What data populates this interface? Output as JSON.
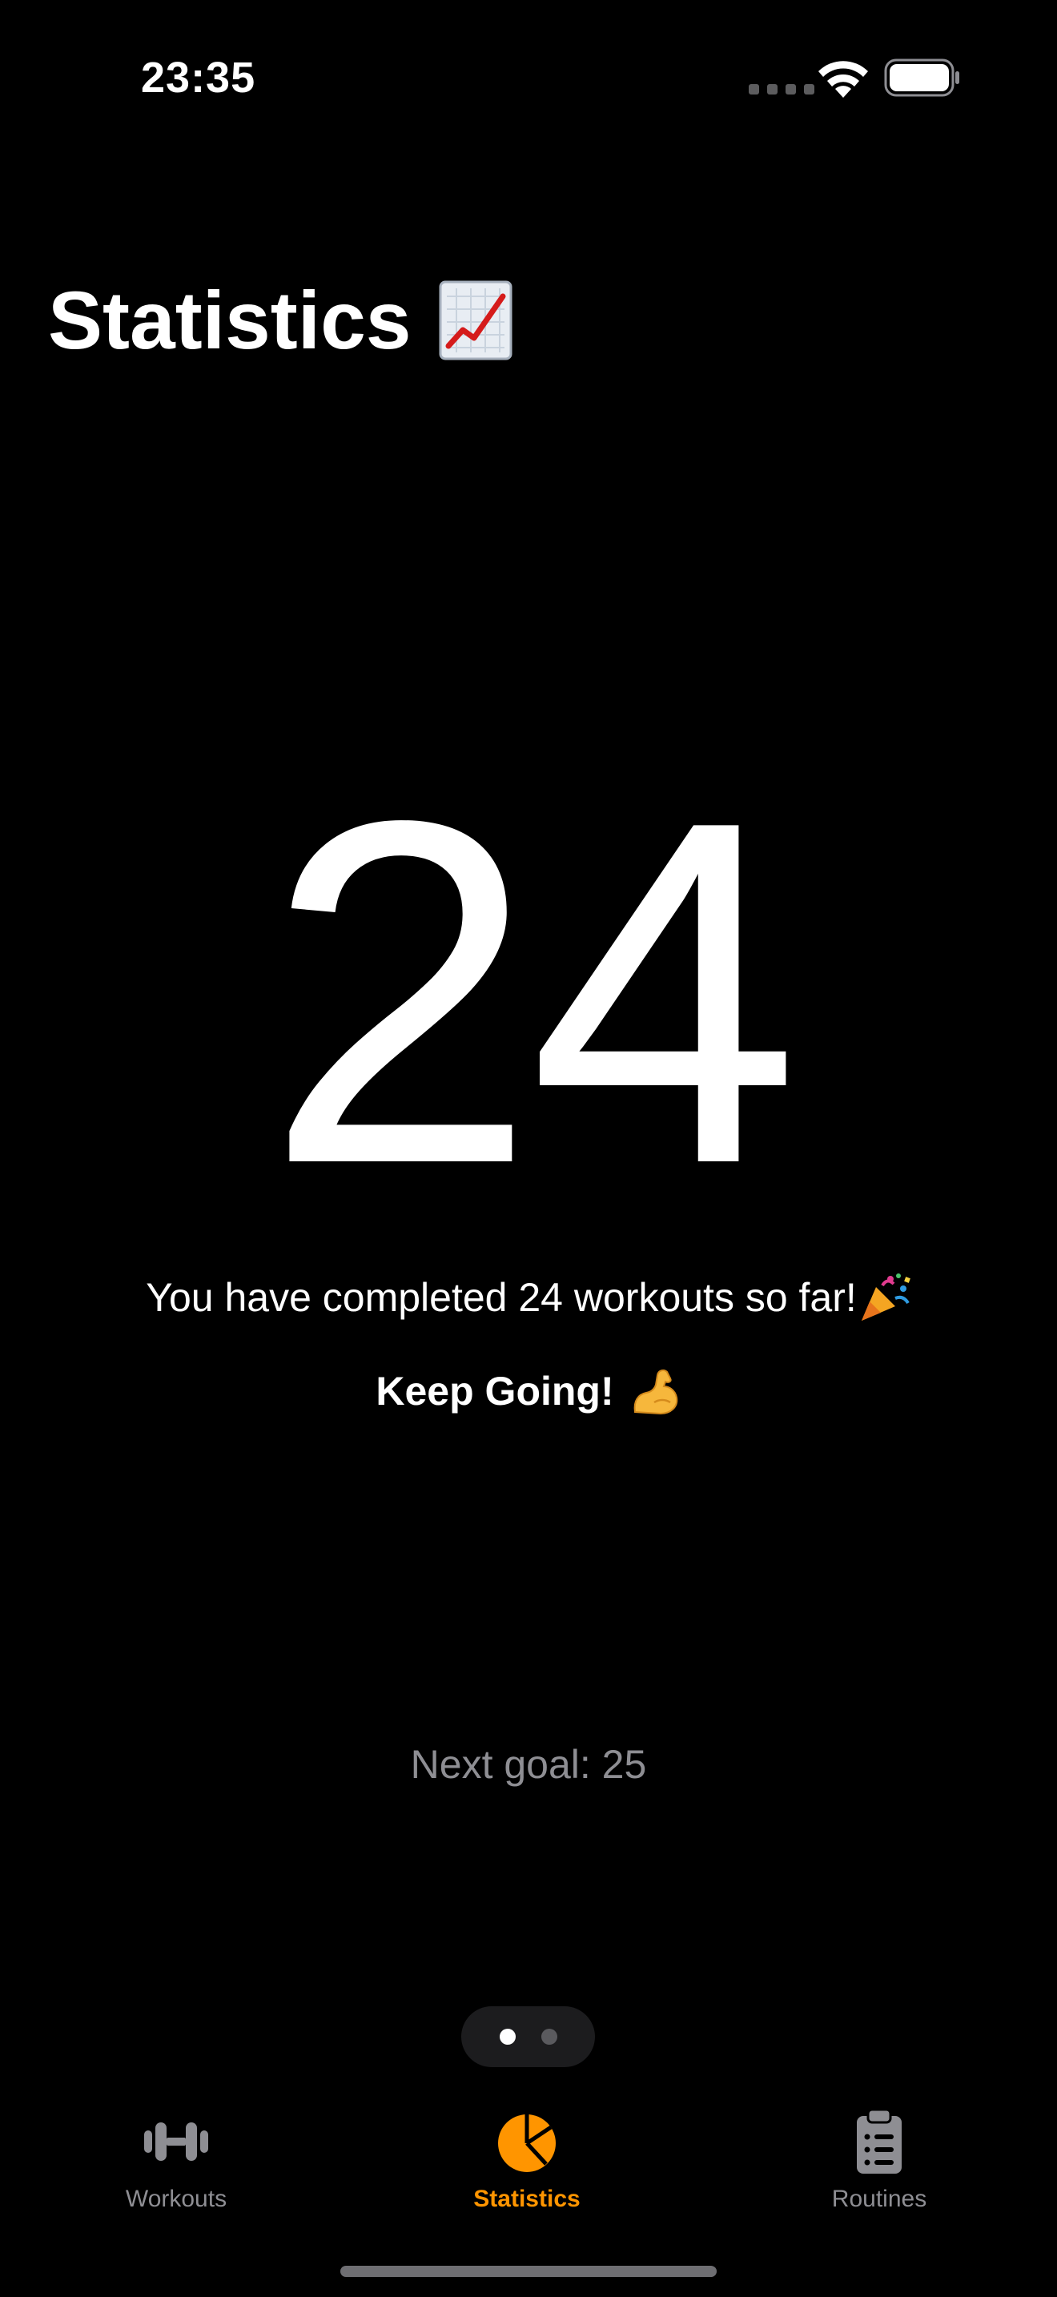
{
  "status_bar": {
    "time": "23:35"
  },
  "header": {
    "title": "Statistics",
    "title_icon": "chart-increasing-icon"
  },
  "main": {
    "count": "24",
    "completed_text": "You have completed 24 workouts so far!",
    "completed_icon": "party-popper-icon",
    "encouragement": "Keep Going!",
    "encouragement_icon": "flexed-biceps-icon",
    "next_goal": "Next goal: 25"
  },
  "page_indicator": {
    "pages": 2,
    "current": 1
  },
  "tab_bar": {
    "tabs": [
      {
        "label": "Workouts",
        "icon": "dumbbell-icon"
      },
      {
        "label": "Statistics",
        "icon": "pie-chart-icon",
        "active": true
      },
      {
        "label": "Routines",
        "icon": "clipboard-list-icon"
      }
    ]
  },
  "colors": {
    "background": "#000000",
    "accent": "#ff9500",
    "secondary_text": "#8e8e93",
    "inactive_tab": "#8e8e93"
  }
}
